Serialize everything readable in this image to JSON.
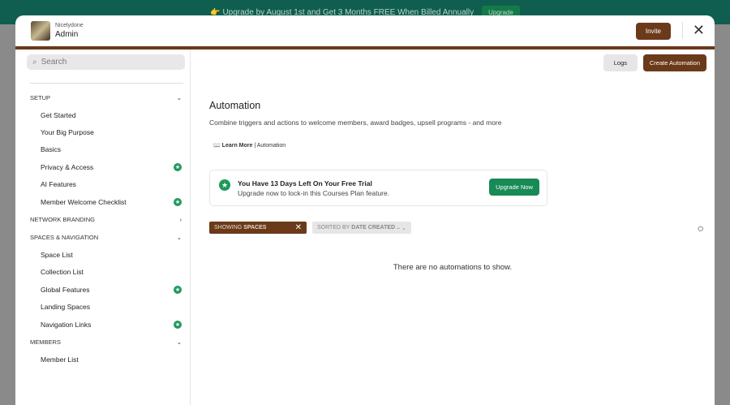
{
  "banner": {
    "text": "👉 Upgrade by August 1st and Get 3 Months FREE When Billed Annually",
    "button": "Upgrade"
  },
  "header": {
    "network": "Nicelydone",
    "title": "Admin",
    "invite": "Invite"
  },
  "sidebar": {
    "search_placeholder": "Search",
    "sections": [
      {
        "label": "SETUP",
        "items": [
          {
            "label": "Get Started"
          },
          {
            "label": "Your Big Purpose"
          },
          {
            "label": "Basics"
          },
          {
            "label": "Privacy & Access",
            "star": true
          },
          {
            "label": "AI Features"
          },
          {
            "label": "Member Welcome Checklist",
            "star": true
          }
        ]
      },
      {
        "label": "NETWORK BRANDING"
      },
      {
        "label": "SPACES & NAVIGATION",
        "items": [
          {
            "label": "Space List"
          },
          {
            "label": "Collection List"
          },
          {
            "label": "Global Features",
            "star": true
          },
          {
            "label": "Landing Spaces"
          },
          {
            "label": "Navigation Links",
            "star": true
          }
        ]
      },
      {
        "label": "MEMBERS",
        "items": [
          {
            "label": "Member List"
          }
        ]
      }
    ]
  },
  "main": {
    "logs": "Logs",
    "create": "Create Automation",
    "title": "Automation",
    "description": "Combine triggers and actions to welcome members, award badges, upsell programs - and more",
    "learn_more": "Learn More",
    "learn_topic": "| Automation",
    "trial": {
      "title": "You Have 13 Days Left On Your Free Trial",
      "subtitle": "Upgrade now to lock-in this Courses Plan feature.",
      "button": "Upgrade Now"
    },
    "filter": {
      "prefix": "SHOWING",
      "value": "SPACES"
    },
    "sort": {
      "prefix": "SORTED BY",
      "value": "DATE CREATED .."
    },
    "empty": "There are no automations to show."
  }
}
